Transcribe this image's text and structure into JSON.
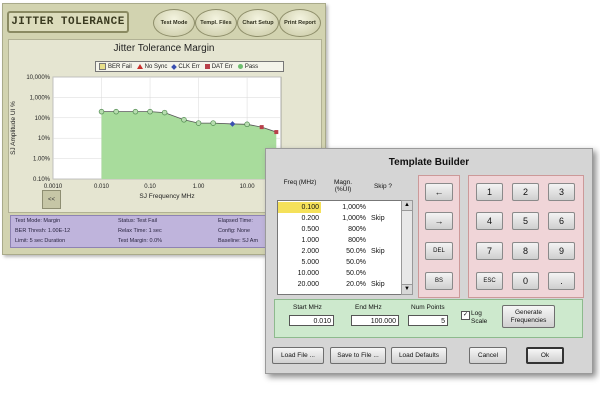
{
  "jt": {
    "title": "JITTER TOLERANCE",
    "buttons": [
      "Test Mode",
      "Templ. Files",
      "Chart Setup",
      "Print Report"
    ],
    "small_button": "<<",
    "status": {
      "c1": [
        "Test Mode: Margin",
        "BER Thresh: 1.00E-12",
        "Limit: 5 sec Duration"
      ],
      "c2": [
        "Status: Test Fail",
        "Relax Time: 1 sec",
        "Test Margin: 0.0%"
      ],
      "c3": [
        "Elapsed Time:",
        "Config: None",
        "Baseline: SJ Am"
      ]
    }
  },
  "chart_data": {
    "type": "line",
    "title": "Jitter Tolerance Margin",
    "xlabel": "SJ Frequency MHz",
    "ylabel": "SJ Amplitude UI %",
    "x_scale": "log",
    "y_scale": "log",
    "x_ticks": [
      "0.0010",
      "0.010",
      "0.10",
      "1.00",
      "10.00"
    ],
    "y_ticks": [
      "10,000%",
      "1,000%",
      "100%",
      "10%",
      "1.00%",
      "0.10%"
    ],
    "xlim": [
      0.001,
      50
    ],
    "ylim": [
      0.1,
      10000
    ],
    "legend": [
      "BER Fail",
      "No Sync",
      "CLK Err",
      "DAT Err",
      "Pass"
    ],
    "legend_colors": [
      "#e8e08a",
      "#c8312c",
      "#3a4fb0",
      "#b8404a",
      "#6fbd6f"
    ],
    "x": [
      0.01,
      0.02,
      0.05,
      0.1,
      0.2,
      0.5,
      1.0,
      2.0,
      5.0,
      10.0,
      20.0,
      40.0
    ],
    "y": [
      200,
      200,
      200,
      200,
      180,
      80,
      55,
      55,
      50,
      48,
      35,
      20
    ],
    "point_status": [
      "Pass",
      "Pass",
      "Pass",
      "Pass",
      "Pass",
      "Pass",
      "Pass",
      "Pass",
      "CLK Err",
      "Pass",
      "DAT Err",
      "DAT Err"
    ],
    "fill_color": "#a8dc9c"
  },
  "tb": {
    "title": "Template Builder",
    "col_freq": "Freq (MHz)",
    "col_magn": "Magn. (%UI)",
    "col_skip": "Skip ?",
    "rows": [
      {
        "freq": "0.100",
        "magn": "1,000%",
        "skip": ""
      },
      {
        "freq": "0.200",
        "magn": "1,000%",
        "skip": "Skip"
      },
      {
        "freq": "0.500",
        "magn": "800%",
        "skip": ""
      },
      {
        "freq": "1.000",
        "magn": "800%",
        "skip": ""
      },
      {
        "freq": "2.000",
        "magn": "50.0%",
        "skip": "Skip"
      },
      {
        "freq": "5.000",
        "magn": "50.0%",
        "skip": ""
      },
      {
        "freq": "10.000",
        "magn": "50.0%",
        "skip": ""
      },
      {
        "freq": "20.000",
        "magn": "20.0%",
        "skip": "Skip"
      }
    ],
    "nav_keys": [
      "←",
      "→",
      "DEL",
      "BS"
    ],
    "num_keys": [
      "1",
      "2",
      "3",
      "4",
      "5",
      "6",
      "7",
      "8",
      "9",
      "ESC",
      "0",
      "."
    ],
    "start_label": "Start MHz",
    "start_value": "0.010",
    "end_label": "End MHz",
    "end_value": "100.000",
    "points_label": "Num Points",
    "points_value": "5",
    "log_label": "Log Scale",
    "generate_label": "Generate Frequencies",
    "load_file": "Load File ...",
    "save_file": "Save to File ...",
    "load_defaults": "Load Defaults",
    "cancel": "Cancel",
    "ok": "Ok"
  }
}
